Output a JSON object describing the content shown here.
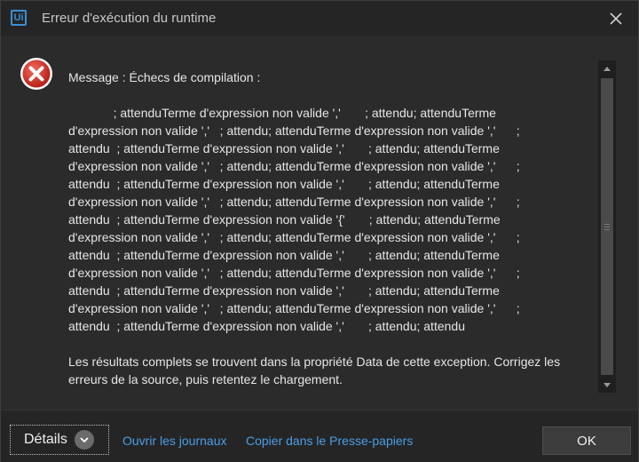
{
  "window": {
    "title": "Erreur d'exécution du runtime",
    "app_logo_text": "Ui"
  },
  "message": {
    "heading": "Message : Échecs de compilation :",
    "lines": [
      "             ; attenduTerme d'expression non valide ','       ; attendu; attenduTerme",
      "d'expression non valide ','   ; attendu; attenduTerme d'expression non valide ','      ;",
      "attendu  ; attenduTerme d'expression non valide ','       ; attendu; attenduTerme",
      "d'expression non valide ','   ; attendu; attenduTerme d'expression non valide ','      ;",
      "attendu  ; attenduTerme d'expression non valide ','       ; attendu; attenduTerme",
      "d'expression non valide ','   ; attendu; attenduTerme d'expression non valide ','      ;",
      "attendu  ; attenduTerme d'expression non valide '{'       ; attendu; attenduTerme",
      "d'expression non valide ','   ; attendu; attenduTerme d'expression non valide ','      ;",
      "attendu  ; attenduTerme d'expression non valide ','       ; attendu; attenduTerme",
      "d'expression non valide ','   ; attendu; attenduTerme d'expression non valide ','      ;",
      "attendu  ; attenduTerme d'expression non valide ','       ; attendu; attenduTerme",
      "d'expression non valide ','   ; attendu; attenduTerme d'expression non valide ','      ;",
      "attendu  ; attenduTerme d'expression non valide ','       ; attendu; attendu"
    ],
    "footer_text": "Les résultats complets se trouvent dans la propriété Data de cette exception. Corrigez les erreurs de la source, puis retentez le chargement."
  },
  "footer": {
    "details_label": "Détails",
    "open_logs_label": "Ouvrir les journaux",
    "copy_label": "Copier dans le Presse-papiers",
    "ok_label": "OK"
  },
  "icons": {
    "app": "uipath-logo-icon",
    "close": "close-icon",
    "error": "error-icon",
    "chevron": "chevron-down-icon"
  },
  "colors": {
    "error_red": "#d9352b",
    "link": "#4a9ee6",
    "logo_blue": "#3b8fd4"
  }
}
